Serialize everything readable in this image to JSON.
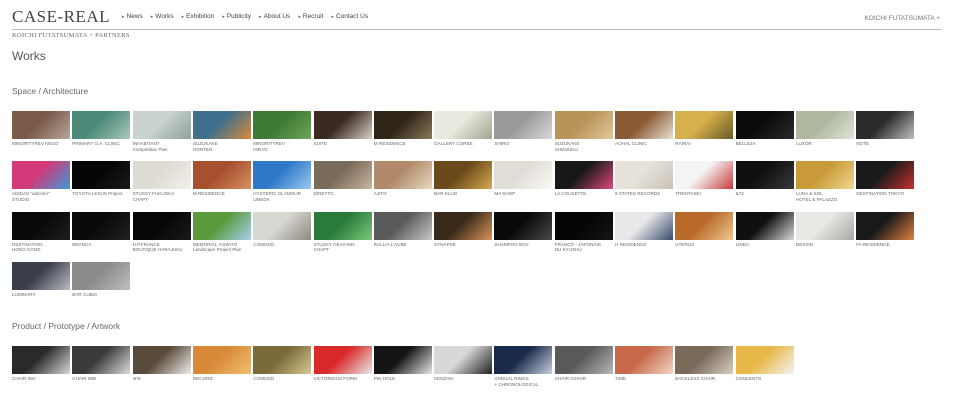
{
  "header": {
    "logo": "CASE-REAL",
    "sublogo": "KOICHI FUTATSUMATA + PARTNERS",
    "nav": [
      "News",
      "Works",
      "Exhibition",
      "Publicity",
      "About Us",
      "Recruit",
      "Contact Us"
    ],
    "right_link": "KOICHI FUTATSUMATA +"
  },
  "page": {
    "title": "Works"
  },
  "sections": [
    {
      "title": "Space / Architecture",
      "items": [
        {
          "label": "MINORITYREV KEGO",
          "colors": [
            "#7a5a4a",
            "#b8a89a"
          ]
        },
        {
          "label": "PRIMARY O.A. CLINIC",
          "colors": [
            "#4e8a7a",
            "#a9c9bd"
          ]
        },
        {
          "label": "INHABITANT\nCompetition Plan",
          "colors": [
            "#c9d2cc",
            "#8fa39a"
          ]
        },
        {
          "label": "SUZUKAKE\nHONTEN",
          "colors": [
            "#3f6f8c",
            "#d98a3a"
          ]
        },
        {
          "label": "MINORITYREV\nHIRAO",
          "colors": [
            "#3f7a34",
            "#6ea35a"
          ]
        },
        {
          "label": "SUITE",
          "colors": [
            "#3a2a22",
            "#d9d2c8"
          ]
        },
        {
          "label": "M RESIDENCE",
          "colors": [
            "#2e2418",
            "#8a7a5a"
          ]
        },
        {
          "label": "GALLERY COREE",
          "colors": [
            "#e9eadf",
            "#9fa58f"
          ]
        },
        {
          "label": "SHIRO",
          "colors": [
            "#9a9a9a",
            "#d8d8d8"
          ]
        },
        {
          "label": "SUZUKAKE\nSHINJUKU",
          "colors": [
            "#b8935a",
            "#e0c89a"
          ]
        },
        {
          "label": "AOHAL CLINIC",
          "colors": [
            "#8a5a32",
            "#e8e2d6"
          ]
        },
        {
          "label": "RAIRAI",
          "colors": [
            "#d6b04a",
            "#6a5a2a"
          ]
        },
        {
          "label": "BELLEZA",
          "colors": [
            "#0c0c0c",
            "#2a2a2a"
          ]
        },
        {
          "label": "LUXOR",
          "colors": [
            "#aeb89e",
            "#dfe3d6"
          ]
        },
        {
          "label": "NOTE",
          "colors": [
            "#2a2a2a",
            "#bfbfbf"
          ]
        },
        {
          "label": "ADIDAS \"adicolor\"\nSTUDIO",
          "colors": [
            "#d23a7a",
            "#3a9ad8"
          ]
        },
        {
          "label": "TOYOTA LEXUS Project",
          "colors": [
            "#050505",
            "#1a1a1a"
          ]
        },
        {
          "label": "STUSSY FUKUOKA\nCHAPT",
          "colors": [
            "#dedbd4",
            "#f2f0ea"
          ]
        },
        {
          "label": "M RESIDENCE",
          "colors": [
            "#a8502e",
            "#d49060"
          ]
        },
        {
          "label": "HYSTERIC GLAMOUR\nUMEDA",
          "colors": [
            "#2f78c8",
            "#9ac8f0"
          ]
        },
        {
          "label": "DIRETTO",
          "colors": [
            "#7a6a5a",
            "#c8b8a0"
          ]
        },
        {
          "label": "AJITO",
          "colors": [
            "#b08a6a",
            "#e8d8c0"
          ]
        },
        {
          "label": "BAR KLUG",
          "colors": [
            "#6a4a1a",
            "#d8a850"
          ]
        },
        {
          "label": "MA SHOP",
          "colors": [
            "#e0dcd6",
            "#faf8f4"
          ]
        },
        {
          "label": "LA COUSETTE",
          "colors": [
            "#181818",
            "#e04a7a"
          ]
        },
        {
          "label": "9 STATES RECORDS",
          "colors": [
            "#e6e2da",
            "#c8c2b6"
          ]
        },
        {
          "label": "TRENTASEI",
          "colors": [
            "#f4f4f4",
            "#c83a3a"
          ]
        },
        {
          "label": "&72",
          "colors": [
            "#101010",
            "#3a3a3a"
          ]
        },
        {
          "label": "LUNA & SOL\nHOTEL & PALAZZO",
          "colors": [
            "#c89a3a",
            "#f0d890"
          ]
        },
        {
          "label": "DESTINATION TOKYO",
          "colors": [
            "#1a1a1a",
            "#c83030"
          ]
        },
        {
          "label": "DESTINATION\nHONG KONG",
          "colors": [
            "#080808",
            "#1e1e1e"
          ]
        },
        {
          "label": "BRANCA",
          "colors": [
            "#0a0a0a",
            "#202020"
          ]
        },
        {
          "label": "H.P.FRANCE\nBOUTIQUE HARAJUKU",
          "colors": [
            "#060606",
            "#1a1a1a"
          ]
        },
        {
          "label": "MEMORIAL YAMATO\nLandscape Project Plan",
          "colors": [
            "#5a9a3a",
            "#a8d0f0"
          ]
        },
        {
          "label": "COMODO",
          "colors": [
            "#d8d8d2",
            "#8a8a80"
          ]
        },
        {
          "label": "STUSSY OKAYAMA\nCHAPT",
          "colors": [
            "#2a7a3a",
            "#7ac87a"
          ]
        },
        {
          "label": "RALLIA L'AUBE",
          "colors": [
            "#5a5a5a",
            "#c8c8c8"
          ]
        },
        {
          "label": "SYNAPSE",
          "colors": [
            "#3a2a1a",
            "#d8945a"
          ]
        },
        {
          "label": "SHAMPOO BOY",
          "colors": [
            "#0a0a0a",
            "#4a4a4a"
          ]
        },
        {
          "label": "FRANCO - JAPONAIS\nDU KYUSHU",
          "colors": [
            "#040404",
            "#161616"
          ]
        },
        {
          "label": "H RESIDENCE",
          "colors": [
            "#e8e8ea",
            "#3a4a6a"
          ]
        },
        {
          "label": "UTERUS",
          "colors": [
            "#b86a2a",
            "#f0c890"
          ]
        },
        {
          "label": "LINDA",
          "colors": [
            "#101010",
            "#d8d8d8"
          ]
        },
        {
          "label": "DESSIN",
          "colors": [
            "#eae8e4",
            "#a8a8a4"
          ]
        },
        {
          "label": "FA RESIDENCE",
          "colors": [
            "#1a1a1a",
            "#e08040"
          ]
        },
        {
          "label": "LUMINARY",
          "colors": [
            "#3a3f4a",
            "#b8bcc4"
          ]
        },
        {
          "label": "BAR CUBIC",
          "colors": [
            "#8a8a88",
            "#c0c0be"
          ]
        }
      ]
    },
    {
      "title": "Product / Prototype / Artwork",
      "items": [
        {
          "label": "CHAIR 08A",
          "colors": [
            "#2a2a2a",
            "#d8d8d8"
          ]
        },
        {
          "label": "CHAIR 08B",
          "colors": [
            "#3a3a3a",
            "#dcdcdc"
          ]
        },
        {
          "label": "4F8",
          "colors": [
            "#5a4a3a",
            "#eeeeee"
          ]
        },
        {
          "label": "RECORD",
          "colors": [
            "#d88a3a",
            "#f0c070"
          ]
        },
        {
          "label": "COMODO",
          "colors": [
            "#7a6a3a",
            "#d8c890"
          ]
        },
        {
          "label": "VICTORIOUS FORM",
          "colors": [
            "#d82a2a",
            "#eaeaea"
          ]
        },
        {
          "label": "PIN HOLE",
          "colors": [
            "#141414",
            "#e8e8e8"
          ]
        },
        {
          "label": "KENZAN",
          "colors": [
            "#d8d8d8",
            "#202020"
          ]
        },
        {
          "label": "ANNUAL RINGS\n+ CHRONOLOGICAL",
          "colors": [
            "#1a2a4a",
            "#c8d0e0"
          ]
        },
        {
          "label": "CHAIR+CHAIR",
          "colors": [
            "#5a5a5a",
            "#b8b8b8"
          ]
        },
        {
          "label": "TIME",
          "colors": [
            "#c86a4a",
            "#f0d8c8"
          ]
        },
        {
          "label": "BACKLESS CHAIR",
          "colors": [
            "#7a6a5a",
            "#d8d0c4"
          ]
        },
        {
          "label": "CONCENTS",
          "colors": [
            "#e8b84a",
            "#f4f4f4"
          ]
        }
      ]
    }
  ]
}
